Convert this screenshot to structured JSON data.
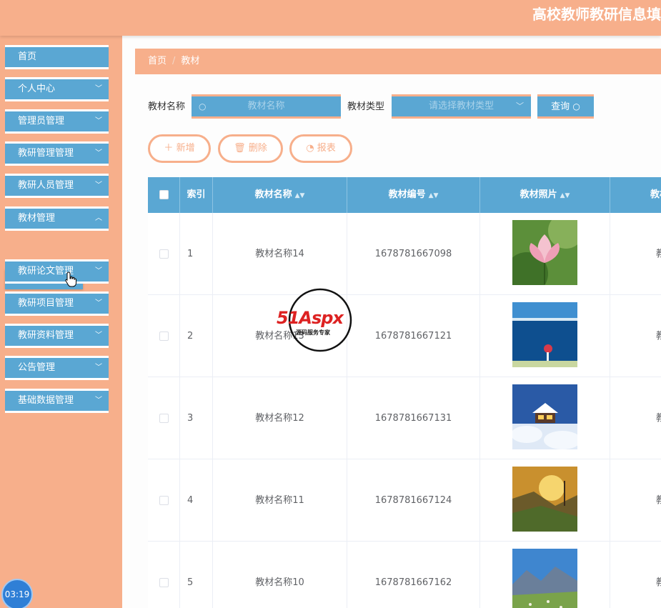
{
  "header": {
    "title": "高校教师教研信息填"
  },
  "sidebar": {
    "items": [
      {
        "label": "首页"
      },
      {
        "label": "个人中心"
      },
      {
        "label": "管理员管理"
      },
      {
        "label": "教研管理管理"
      },
      {
        "label": "教研人员管理"
      },
      {
        "label": "教材管理"
      },
      {
        "label": "教研论文管理"
      },
      {
        "label": "教研项目管理"
      },
      {
        "label": "教研资料管理"
      },
      {
        "label": "公告管理"
      },
      {
        "label": "基础数据管理"
      }
    ],
    "submenu": {
      "label": "教材管理"
    }
  },
  "timer": "03:19",
  "breadcrumb": {
    "home": "首页",
    "current": "教材"
  },
  "filters": {
    "name_label": "教材名称",
    "name_placeholder": "教材名称",
    "type_label": "教材类型",
    "type_placeholder": "请选择教材类型",
    "search_label": "查询"
  },
  "actions": {
    "add": "新增",
    "delete": "删除",
    "report": "报表"
  },
  "table": {
    "columns": {
      "index": "索引",
      "name": "教材名称",
      "code": "教材编号",
      "photo": "教材照片",
      "type": "教材"
    },
    "rows": [
      {
        "index": "1",
        "name": "教材名称14",
        "code": "1678781667098",
        "type": "教",
        "photo": "lotus"
      },
      {
        "index": "2",
        "name": "教材名称13",
        "code": "1678781667121",
        "type": "教",
        "photo": "lake"
      },
      {
        "index": "3",
        "name": "教材名称12",
        "code": "1678781667131",
        "type": "教",
        "photo": "snow-cabin"
      },
      {
        "index": "4",
        "name": "教材名称11",
        "code": "1678781667124",
        "type": "教",
        "photo": "sunset-hills"
      },
      {
        "index": "5",
        "name": "教材名称10",
        "code": "1678781667162",
        "type": "教",
        "photo": "mountain-meadow"
      }
    ]
  },
  "watermark": {
    "brand": "51Aspx",
    "tagline": "源码服务专家"
  },
  "colors": {
    "accent": "#f7af8b",
    "primary": "#5aa7d3"
  }
}
